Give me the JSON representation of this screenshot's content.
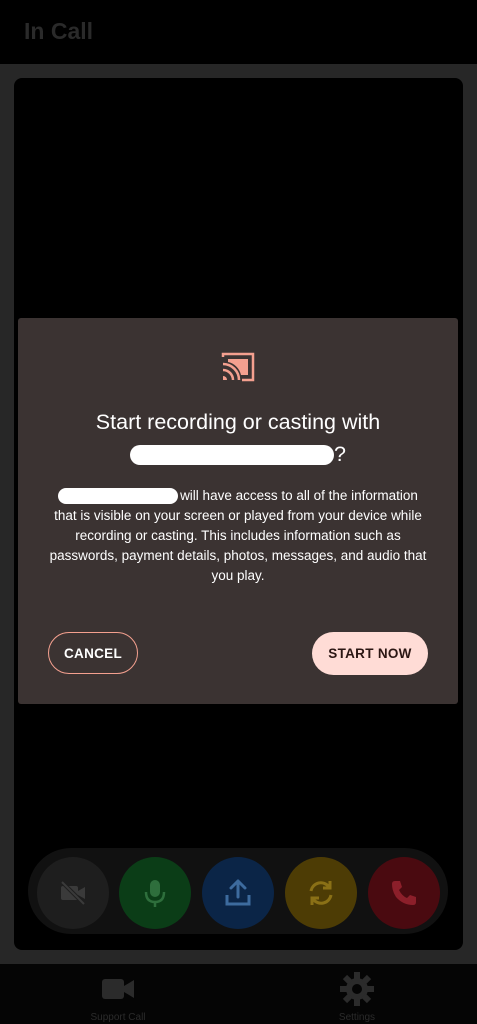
{
  "app_bar": {
    "title": "In Call"
  },
  "call_controls": {
    "buttons": [
      {
        "name": "camera-off",
        "icon": "video-off-icon",
        "color": "#1e1e1e"
      },
      {
        "name": "microphone",
        "icon": "microphone-icon",
        "color": "#0b3d17"
      },
      {
        "name": "share-screen",
        "icon": "upload-icon",
        "color": "#0b2547"
      },
      {
        "name": "switch-camera",
        "icon": "refresh-icon",
        "color": "#4d3c05"
      },
      {
        "name": "end-call",
        "icon": "phone-icon",
        "color": "#4a0a10"
      }
    ]
  },
  "dialog": {
    "icon": "cast-icon",
    "title_line1": "Start recording or casting with",
    "title_suffix": "?",
    "body_line1_suffix": "will have access to all of the information",
    "body_rest": "that is visible on your screen or played from your device while recording or casting. This includes information such as passwords, payment details, photos, messages, and audio that you play.",
    "cancel_label": "CANCEL",
    "start_label": "START NOW",
    "accent": "#f4a08f"
  },
  "bottom_nav": {
    "items": [
      {
        "label": "Support Call",
        "icon": "video-camera-icon"
      },
      {
        "label": "Settings",
        "icon": "gear-icon"
      }
    ]
  }
}
